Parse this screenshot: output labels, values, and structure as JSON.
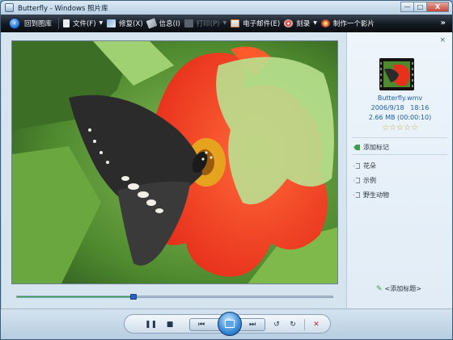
{
  "window": {
    "title": "Butterfly - Windows 照片库"
  },
  "title_buttons": {
    "minimize": "—",
    "maximize": "□",
    "close": "X"
  },
  "toolbar": {
    "items": [
      {
        "label": "回到图库",
        "icon": "back-arrow-icon"
      },
      {
        "label": "文件(F)",
        "icon": "file-icon",
        "dropdown": true
      },
      {
        "label": "修复(X)",
        "icon": "fix-icon"
      },
      {
        "label": "信息(I)",
        "icon": "info-icon"
      },
      {
        "label": "打印(P)",
        "icon": "print-icon",
        "dropdown": true,
        "disabled": true
      },
      {
        "label": "电子邮件(E)",
        "icon": "email-icon"
      },
      {
        "label": "刻录",
        "icon": "burn-icon",
        "dropdown": true
      },
      {
        "label": "制作一个影片",
        "icon": "movie-icon"
      }
    ],
    "more": "»"
  },
  "player": {
    "progress": 0.37
  },
  "info_panel": {
    "close": "×",
    "filename": "Butterfly.wmv",
    "date": "2006/9/18",
    "time": "18:16",
    "size": "2.66 MB (00:00:10)",
    "rating": 0,
    "rating_symbol": "☆☆☆☆☆",
    "add_tag": "添加标记",
    "tags": [
      "花朵",
      "示例",
      "野生动物"
    ],
    "add_caption": "<添加标题>"
  },
  "controls": {
    "pause": "❚❚",
    "stop": "■",
    "prev": "⏮",
    "next": "⏭",
    "rotate_left": "↺",
    "rotate_right": "↻",
    "delete": "✕"
  },
  "colors": {
    "toolbar_bg": "#141a22",
    "link": "#1c5ea8",
    "seek_fill": "#2aa83b",
    "delete_red": "#d0202a"
  }
}
